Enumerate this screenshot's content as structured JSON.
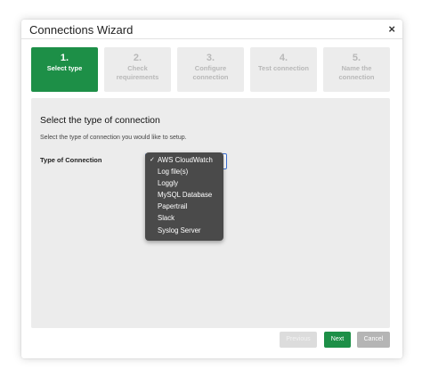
{
  "dialog": {
    "title": "Connections Wizard",
    "close_label": "×"
  },
  "steps": [
    {
      "number": "1.",
      "label": "Select type",
      "active": true
    },
    {
      "number": "2.",
      "label": "Check requirements",
      "active": false
    },
    {
      "number": "3.",
      "label": "Configure connection",
      "active": false
    },
    {
      "number": "4.",
      "label": "Test connection",
      "active": false
    },
    {
      "number": "5.",
      "label": "Name the connection",
      "active": false
    }
  ],
  "content": {
    "section_title": "Select the type of connection",
    "section_description": "Select the type of connection you would like to setup.",
    "field_label": "Type of Connection"
  },
  "dropdown": {
    "check_glyph": "✓",
    "selected": "AWS CloudWatch",
    "options": [
      "AWS CloudWatch",
      "Log file(s)",
      "Loggly",
      "MySQL Database",
      "Papertrail",
      "Slack",
      "Syslog Server"
    ]
  },
  "footer": {
    "previous_label": "Previous",
    "next_label": "Next",
    "cancel_label": "Cancel"
  },
  "colors": {
    "accent": "#1d8f47",
    "dropdown_bg": "#4a4a4a",
    "panel_bg": "#ececec"
  }
}
